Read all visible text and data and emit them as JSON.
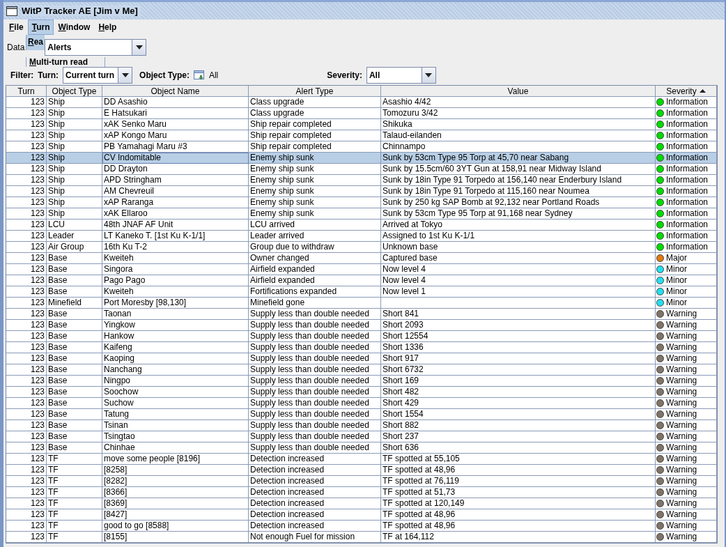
{
  "window": {
    "title": "WitP Tracker AE [Jim v Me]"
  },
  "menu": [
    {
      "label": "File",
      "selected": false
    },
    {
      "label": "Turn",
      "selected": true
    },
    {
      "label": "Window",
      "selected": false
    },
    {
      "label": "Help",
      "selected": false
    }
  ],
  "menu_popup": [
    {
      "label": "Rea",
      "selected": true
    },
    {
      "label": "Multi-turn read",
      "selected": false
    }
  ],
  "data_row": {
    "label": "Data",
    "combo": "Alerts"
  },
  "filter": {
    "label": "Filter:",
    "turn_label": "Turn:",
    "turn_value": "Current turn",
    "object_type_label": "Object Type:",
    "object_type_value": "All",
    "severity_label": "Severity:",
    "severity_value": "All"
  },
  "table": {
    "columns": [
      "Turn",
      "Object Type",
      "Object Name",
      "Alert Type",
      "Value",
      "Severity"
    ],
    "rows": [
      {
        "turn": "123",
        "object_type": "Ship",
        "object_name": "DD Asashio",
        "alert_type": "Class upgrade",
        "value": "Asashio 4/42",
        "severity": "Information",
        "color": "#00dd00",
        "selected": false
      },
      {
        "turn": "123",
        "object_type": "Ship",
        "object_name": "E Hatsukari",
        "alert_type": "Class upgrade",
        "value": "Tomozuru 3/42",
        "severity": "Information",
        "color": "#00dd00",
        "selected": false
      },
      {
        "turn": "123",
        "object_type": "Ship",
        "object_name": "xAK Senko Maru",
        "alert_type": "Ship repair completed",
        "value": "Shikuka",
        "severity": "Information",
        "color": "#00dd00",
        "selected": false
      },
      {
        "turn": "123",
        "object_type": "Ship",
        "object_name": "xAP Kongo Maru",
        "alert_type": "Ship repair completed",
        "value": "Talaud-eilanden",
        "severity": "Information",
        "color": "#00dd00",
        "selected": false
      },
      {
        "turn": "123",
        "object_type": "Ship",
        "object_name": "PB Yamahagi Maru #3",
        "alert_type": "Ship repair completed",
        "value": "Chinnampo",
        "severity": "Information",
        "color": "#00dd00",
        "selected": false
      },
      {
        "turn": "123",
        "object_type": "Ship",
        "object_name": "CV Indomitable",
        "alert_type": "Enemy ship sunk",
        "value": "Sunk by 53cm Type 95 Torp at 45,70 near Sabang",
        "severity": "Information",
        "color": "#00dd00",
        "selected": true
      },
      {
        "turn": "123",
        "object_type": "Ship",
        "object_name": "DD Drayton",
        "alert_type": "Enemy ship sunk",
        "value": "Sunk by 15.5cm/60 3YT Gun at 158,91 near Midway Island",
        "severity": "Information",
        "color": "#00dd00",
        "selected": false
      },
      {
        "turn": "123",
        "object_type": "Ship",
        "object_name": "APD Stringham",
        "alert_type": "Enemy ship sunk",
        "value": "Sunk by 18in Type 91 Torpedo at 156,140 near Enderbury Island",
        "severity": "Information",
        "color": "#00dd00",
        "selected": false
      },
      {
        "turn": "123",
        "object_type": "Ship",
        "object_name": "AM Chevreuil",
        "alert_type": "Enemy ship sunk",
        "value": "Sunk by 18in Type 91 Torpedo at 115,160 near Noumea",
        "severity": "Information",
        "color": "#00dd00",
        "selected": false
      },
      {
        "turn": "123",
        "object_type": "Ship",
        "object_name": "xAP Raranga",
        "alert_type": "Enemy ship sunk",
        "value": "Sunk by 250 kg SAP Bomb at 92,132 near Portland Roads",
        "severity": "Information",
        "color": "#00dd00",
        "selected": false
      },
      {
        "turn": "123",
        "object_type": "Ship",
        "object_name": "xAK Ellaroo",
        "alert_type": "Enemy ship sunk",
        "value": "Sunk by 53cm Type 95 Torp at 91,168 near Sydney",
        "severity": "Information",
        "color": "#00dd00",
        "selected": false
      },
      {
        "turn": "123",
        "object_type": "LCU",
        "object_name": "48th JNAF AF Unit",
        "alert_type": "LCU arrived",
        "value": "Arrived at Tokyo",
        "severity": "Information",
        "color": "#00dd00",
        "selected": false
      },
      {
        "turn": "123",
        "object_type": "Leader",
        "object_name": "LT Kaneko T. [1st Ku K-1/1]",
        "alert_type": "Leader arrived",
        "value": "Assigned to 1st Ku K-1/1",
        "severity": "Information",
        "color": "#00dd00",
        "selected": false
      },
      {
        "turn": "123",
        "object_type": "Air Group",
        "object_name": "16th Ku T-2",
        "alert_type": "Group due to withdraw",
        "value": "Unknown base",
        "severity": "Information",
        "color": "#00dd00",
        "selected": false
      },
      {
        "turn": "123",
        "object_type": "Base",
        "object_name": "Kweiteh",
        "alert_type": "Owner changed",
        "value": "Captured base",
        "severity": "Major",
        "color": "#e07a10",
        "selected": false
      },
      {
        "turn": "123",
        "object_type": "Base",
        "object_name": "Singora",
        "alert_type": "Airfield expanded",
        "value": "Now level 4",
        "severity": "Minor",
        "color": "#20e0f0",
        "selected": false
      },
      {
        "turn": "123",
        "object_type": "Base",
        "object_name": "Pago Pago",
        "alert_type": "Airfield expanded",
        "value": "Now level 4",
        "severity": "Minor",
        "color": "#20e0f0",
        "selected": false
      },
      {
        "turn": "123",
        "object_type": "Base",
        "object_name": "Kweiteh",
        "alert_type": "Fortifications expanded",
        "value": "Now level 1",
        "severity": "Minor",
        "color": "#20e0f0",
        "selected": false
      },
      {
        "turn": "123",
        "object_type": "Minefield",
        "object_name": "Port Moresby [98,130]",
        "alert_type": "Minefield gone",
        "severity": "Minor",
        "color": "#20e0f0",
        "selected": false
      },
      {
        "turn": "123",
        "object_type": "Base",
        "object_name": "Taonan",
        "alert_type": "Supply less than double needed",
        "value": "Short 841",
        "severity": "Warning",
        "color": "#807468",
        "selected": false
      },
      {
        "turn": "123",
        "object_type": "Base",
        "object_name": "Yingkow",
        "alert_type": "Supply less than double needed",
        "value": "Short 2093",
        "severity": "Warning",
        "color": "#807468",
        "selected": false
      },
      {
        "turn": "123",
        "object_type": "Base",
        "object_name": "Hankow",
        "alert_type": "Supply less than double needed",
        "value": "Short 12554",
        "severity": "Warning",
        "color": "#807468",
        "selected": false
      },
      {
        "turn": "123",
        "object_type": "Base",
        "object_name": "Kaifeng",
        "alert_type": "Supply less than double needed",
        "value": "Short 1336",
        "severity": "Warning",
        "color": "#807468",
        "selected": false
      },
      {
        "turn": "123",
        "object_type": "Base",
        "object_name": "Kaoping",
        "alert_type": "Supply less than double needed",
        "value": "Short 917",
        "severity": "Warning",
        "color": "#807468",
        "selected": false
      },
      {
        "turn": "123",
        "object_type": "Base",
        "object_name": "Nanchang",
        "alert_type": "Supply less than double needed",
        "value": "Short 6732",
        "severity": "Warning",
        "color": "#807468",
        "selected": false
      },
      {
        "turn": "123",
        "object_type": "Base",
        "object_name": "Ningpo",
        "alert_type": "Supply less than double needed",
        "value": "Short 169",
        "severity": "Warning",
        "color": "#807468",
        "selected": false
      },
      {
        "turn": "123",
        "object_type": "Base",
        "object_name": "Soochow",
        "alert_type": "Supply less than double needed",
        "value": "Short 482",
        "severity": "Warning",
        "color": "#807468",
        "selected": false
      },
      {
        "turn": "123",
        "object_type": "Base",
        "object_name": "Suchow",
        "alert_type": "Supply less than double needed",
        "value": "Short 429",
        "severity": "Warning",
        "color": "#807468",
        "selected": false
      },
      {
        "turn": "123",
        "object_type": "Base",
        "object_name": "Tatung",
        "alert_type": "Supply less than double needed",
        "value": "Short 1554",
        "severity": "Warning",
        "color": "#807468",
        "selected": false
      },
      {
        "turn": "123",
        "object_type": "Base",
        "object_name": "Tsinan",
        "alert_type": "Supply less than double needed",
        "value": "Short 882",
        "severity": "Warning",
        "color": "#807468",
        "selected": false
      },
      {
        "turn": "123",
        "object_type": "Base",
        "object_name": "Tsingtao",
        "alert_type": "Supply less than double needed",
        "value": "Short 237",
        "severity": "Warning",
        "color": "#807468",
        "selected": false
      },
      {
        "turn": "123",
        "object_type": "Base",
        "object_name": "Chinhae",
        "alert_type": "Supply less than double needed",
        "value": "Short 636",
        "severity": "Warning",
        "color": "#807468",
        "selected": false
      },
      {
        "turn": "123",
        "object_type": "TF",
        "object_name": "move some people [8196]",
        "alert_type": "Detection increased",
        "value": "TF spotted at 55,105",
        "severity": "Warning",
        "color": "#807468",
        "selected": false
      },
      {
        "turn": "123",
        "object_type": "TF",
        "object_name": "[8258]",
        "alert_type": "Detection increased",
        "value": "TF spotted at 48,96",
        "severity": "Warning",
        "color": "#807468",
        "selected": false
      },
      {
        "turn": "123",
        "object_type": "TF",
        "object_name": "[8282]",
        "alert_type": "Detection increased",
        "value": "TF spotted at 76,119",
        "severity": "Warning",
        "color": "#807468",
        "selected": false
      },
      {
        "turn": "123",
        "object_type": "TF",
        "object_name": "[8366]",
        "alert_type": "Detection increased",
        "value": "TF spotted at 51,73",
        "severity": "Warning",
        "color": "#807468",
        "selected": false
      },
      {
        "turn": "123",
        "object_type": "TF",
        "object_name": "[8369]",
        "alert_type": "Detection increased",
        "value": "TF spotted at 120,149",
        "severity": "Warning",
        "color": "#807468",
        "selected": false
      },
      {
        "turn": "123",
        "object_type": "TF",
        "object_name": "[8427]",
        "alert_type": "Detection increased",
        "value": "TF spotted at 48,96",
        "severity": "Warning",
        "color": "#807468",
        "selected": false
      },
      {
        "turn": "123",
        "object_type": "TF",
        "object_name": "good to go [8588]",
        "alert_type": "Detection increased",
        "value": "TF spotted at 48,96",
        "severity": "Warning",
        "color": "#807468",
        "selected": false
      },
      {
        "turn": "123",
        "object_type": "TF",
        "object_name": "[8155]",
        "alert_type": "Not enough Fuel for mission",
        "value": "TF at 164,112",
        "severity": "Warning",
        "color": "#807468",
        "selected": false
      }
    ]
  }
}
